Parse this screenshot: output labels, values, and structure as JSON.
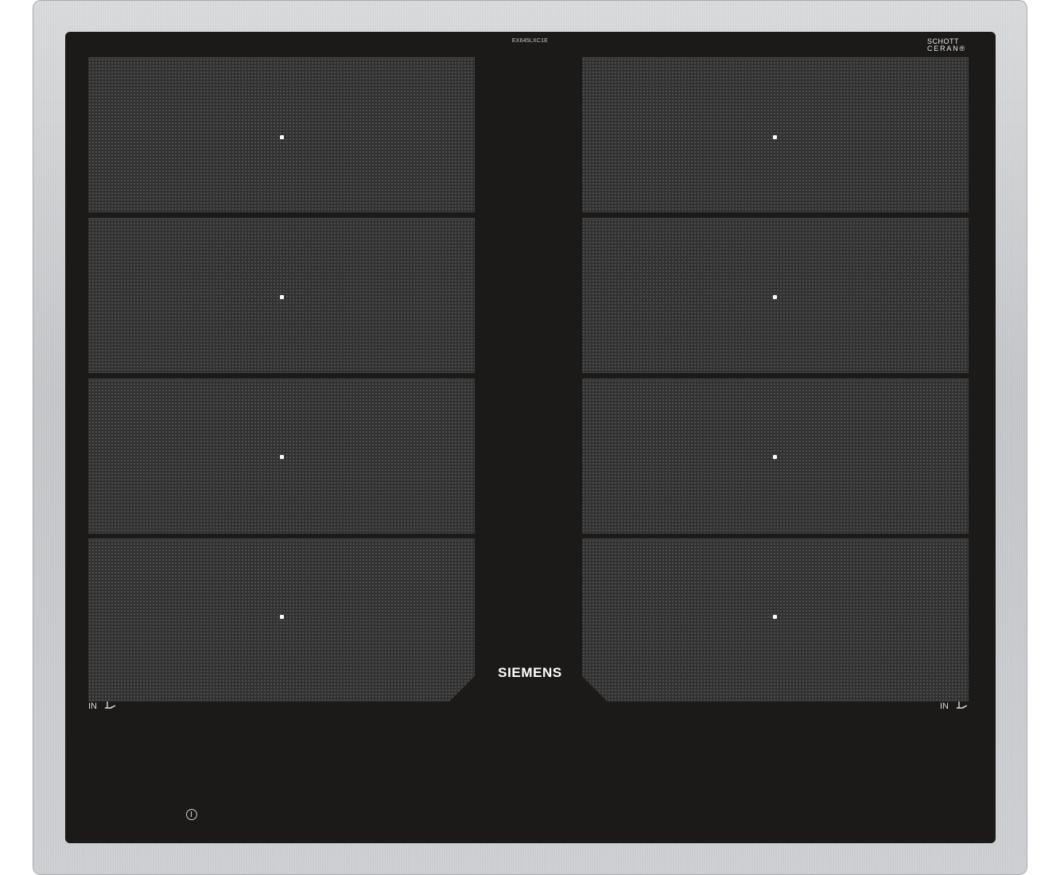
{
  "product": {
    "model_code": "EX645LXC1E",
    "brand": "SIEMENS",
    "glass_brand_line1": "SCHOTT",
    "glass_brand_line2": "CERAN",
    "glass_brand_registered": "®"
  },
  "zones": {
    "left_columns": 4,
    "right_columns": 4,
    "marker_color": "#ffffff"
  },
  "controls": {
    "left_in_label": "IN",
    "right_in_label": "IN",
    "pan_icon": "pan-symbol-icon",
    "power_icon": "power-icon"
  },
  "colors": {
    "frame": "#c8cacd",
    "glass": "#1b1a19",
    "zone": "#313131",
    "text": "#ffffff"
  }
}
